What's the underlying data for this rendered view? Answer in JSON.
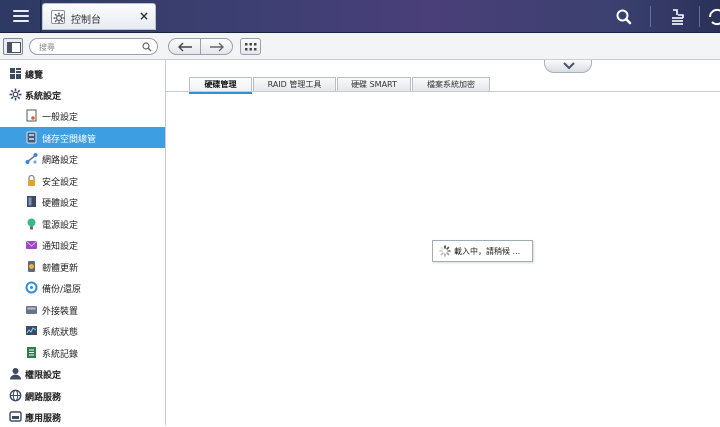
{
  "app": {
    "tab_title": "控制台",
    "tab_icon": "gear-icon",
    "close_symbol": "×"
  },
  "topbar": {
    "icons": [
      "search-icon",
      "stack-icon",
      "sync-icon"
    ]
  },
  "toolbar": {
    "search_placeholder": "搜尋",
    "back_icon": "arrow-left-icon",
    "forward_icon": "arrow-right-icon",
    "grid_icon": "grid-icon"
  },
  "sidebar": {
    "items": [
      {
        "label": "總覽",
        "level": "top",
        "icon": "overview-icon"
      },
      {
        "label": "系統設定",
        "level": "top",
        "icon": "gear-icon"
      },
      {
        "label": "一般設定",
        "level": "sub",
        "icon": "general-settings-icon"
      },
      {
        "label": "儲存空間總管",
        "level": "sub",
        "icon": "storage-icon",
        "active": true
      },
      {
        "label": "網路設定",
        "level": "sub",
        "icon": "network-icon"
      },
      {
        "label": "安全設定",
        "level": "sub",
        "icon": "lock-icon"
      },
      {
        "label": "硬體設定",
        "level": "sub",
        "icon": "hardware-icon"
      },
      {
        "label": "電源設定",
        "level": "sub",
        "icon": "power-icon"
      },
      {
        "label": "通知設定",
        "level": "sub",
        "icon": "notification-icon"
      },
      {
        "label": "韌體更新",
        "level": "sub",
        "icon": "firmware-icon"
      },
      {
        "label": "備份/還原",
        "level": "sub",
        "icon": "backup-icon"
      },
      {
        "label": "外接裝置",
        "level": "sub",
        "icon": "external-device-icon"
      },
      {
        "label": "系統狀態",
        "level": "sub",
        "icon": "system-status-icon"
      },
      {
        "label": "系統記錄",
        "level": "sub",
        "icon": "system-log-icon"
      },
      {
        "label": "權限設定",
        "level": "top",
        "icon": "user-icon"
      },
      {
        "label": "網路服務",
        "level": "top",
        "icon": "network-service-icon"
      },
      {
        "label": "應用服務",
        "level": "top",
        "icon": "app-service-icon"
      }
    ]
  },
  "main": {
    "tabs": [
      {
        "label": "硬碟管理",
        "active": true
      },
      {
        "label": "RAID 管理工具"
      },
      {
        "label": "硬碟 SMART"
      },
      {
        "label": "檔案系統加密"
      }
    ],
    "loading_text": "載入中，請稍候 ...",
    "collapse_icon": "chevron-down-icon"
  },
  "colors": {
    "active_item": "#3d9ee2",
    "active_tab_underline": "#2f8fd8",
    "topbar": "#3d3f73"
  }
}
